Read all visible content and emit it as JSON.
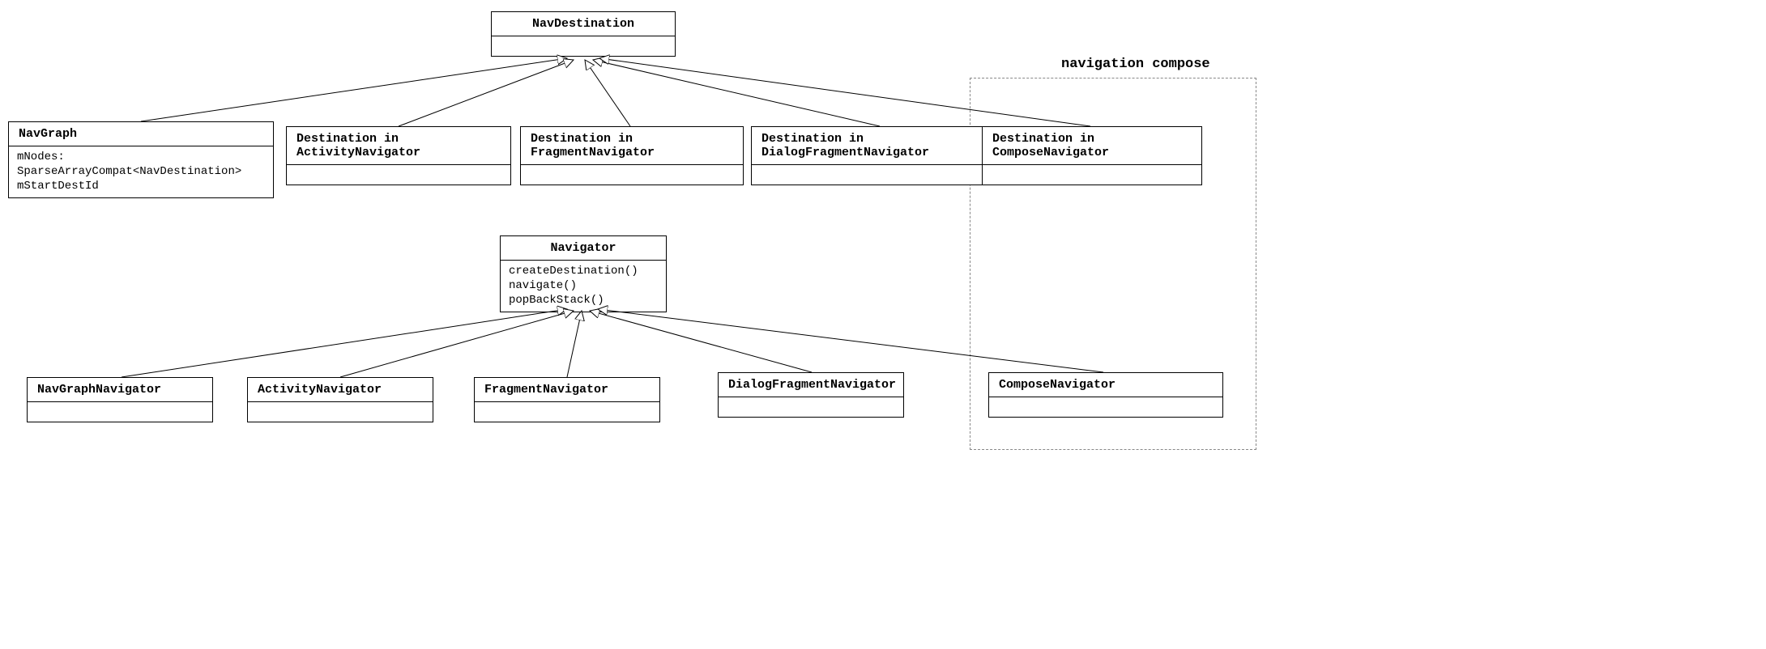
{
  "package": {
    "label": "navigation compose"
  },
  "navDestination": {
    "title": "NavDestination"
  },
  "navGraph": {
    "title": "NavGraph",
    "attr1": "mNodes: SparseArrayCompat<NavDestination>",
    "attr2": "mStartDestId"
  },
  "destActivityNav": {
    "title": "Destination in ActivityNavigator"
  },
  "destFragmentNav": {
    "title": "Destination in FragmentNavigator"
  },
  "destDialogFragmentNav": {
    "title": "Destination in DialogFragmentNavigator"
  },
  "destComposeNav": {
    "title": "Destination in ComposeNavigator"
  },
  "navigator": {
    "title": "Navigator",
    "m1": "createDestination()",
    "m2": "navigate()",
    "m3": "popBackStack()"
  },
  "navGraphNavigator": {
    "title": "NavGraphNavigator"
  },
  "activityNavigator": {
    "title": "ActivityNavigator"
  },
  "fragmentNavigator": {
    "title": "FragmentNavigator"
  },
  "dialogFragmentNavigator": {
    "title": "DialogFragmentNavigator"
  },
  "composeNavigator": {
    "title": "ComposeNavigator"
  }
}
